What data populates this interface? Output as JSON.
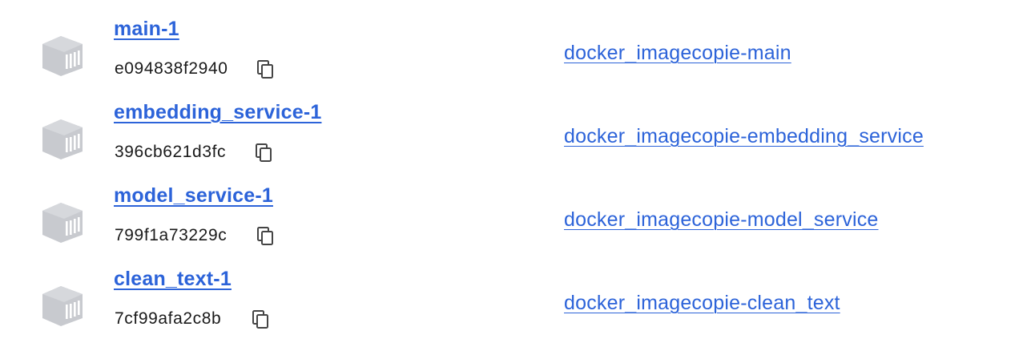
{
  "containers": [
    {
      "name": "main-1",
      "id": "e094838f2940",
      "image": "docker_imagecopie-main"
    },
    {
      "name": "embedding_service-1",
      "id": "396cb621d3fc",
      "image": "docker_imagecopie-embedding_service"
    },
    {
      "name": "model_service-1",
      "id": "799f1a73229c",
      "image": "docker_imagecopie-model_service"
    },
    {
      "name": "clean_text-1",
      "id": "7cf99afa2c8b",
      "image": "docker_imagecopie-clean_text"
    }
  ],
  "icons": {
    "container": "container-icon",
    "copy": "copy-icon"
  },
  "colors": {
    "link": "#2c63d9",
    "icon_gray": "#c8cacf",
    "text": "#1a1a1a"
  }
}
